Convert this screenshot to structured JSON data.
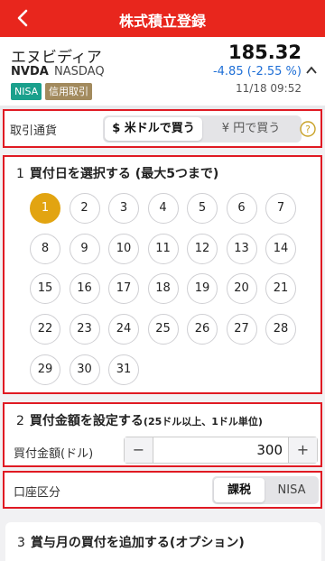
{
  "header": {
    "title": "株式積立登録"
  },
  "stock": {
    "name": "エヌビディア",
    "ticker": "NVDA",
    "exchange": "NASDAQ",
    "badges": {
      "nisa": "NISA",
      "margin": "信用取引"
    },
    "price": "185.32",
    "change": "-4.85 (-2.55 %)",
    "timestamp": "11/18 09:52"
  },
  "currency": {
    "label": "取引通貨",
    "options": [
      "$ 米ドルで買う",
      "¥ 円で買う"
    ],
    "selected": "$ 米ドルで買う"
  },
  "day_section": {
    "number": "1",
    "title": "買付日を選択する (最大5つまで)",
    "days": [
      "1",
      "2",
      "3",
      "4",
      "5",
      "6",
      "7",
      "8",
      "9",
      "10",
      "11",
      "12",
      "13",
      "14",
      "15",
      "16",
      "17",
      "18",
      "19",
      "20",
      "21",
      "22",
      "23",
      "24",
      "25",
      "26",
      "27",
      "28",
      "29",
      "30",
      "31"
    ],
    "selected_days": [
      "1"
    ]
  },
  "amount_section": {
    "number": "2",
    "title": "買付金額を設定する",
    "note": "(25ドル以上、1ドル単位)",
    "label": "買付金額(ドル)",
    "minus": "−",
    "value": "300",
    "plus": "+"
  },
  "account": {
    "label": "口座区分",
    "options": [
      "課税",
      "NISA"
    ],
    "selected": "課税"
  },
  "bonus_section": {
    "number": "3",
    "title": "賞与月の買付を追加する(オプション)"
  },
  "colors": {
    "brand_red": "#e8261d",
    "outline_red": "#e01a23",
    "selected_day": "#e2a411",
    "change_blue": "#1f6fd6",
    "nisa_badge": "#1aa08c",
    "margin_badge": "#a28a5d"
  },
  "icons": {
    "back": "chevron-left-icon",
    "help": "question-circle-icon",
    "caret": "caret-up-icon"
  }
}
